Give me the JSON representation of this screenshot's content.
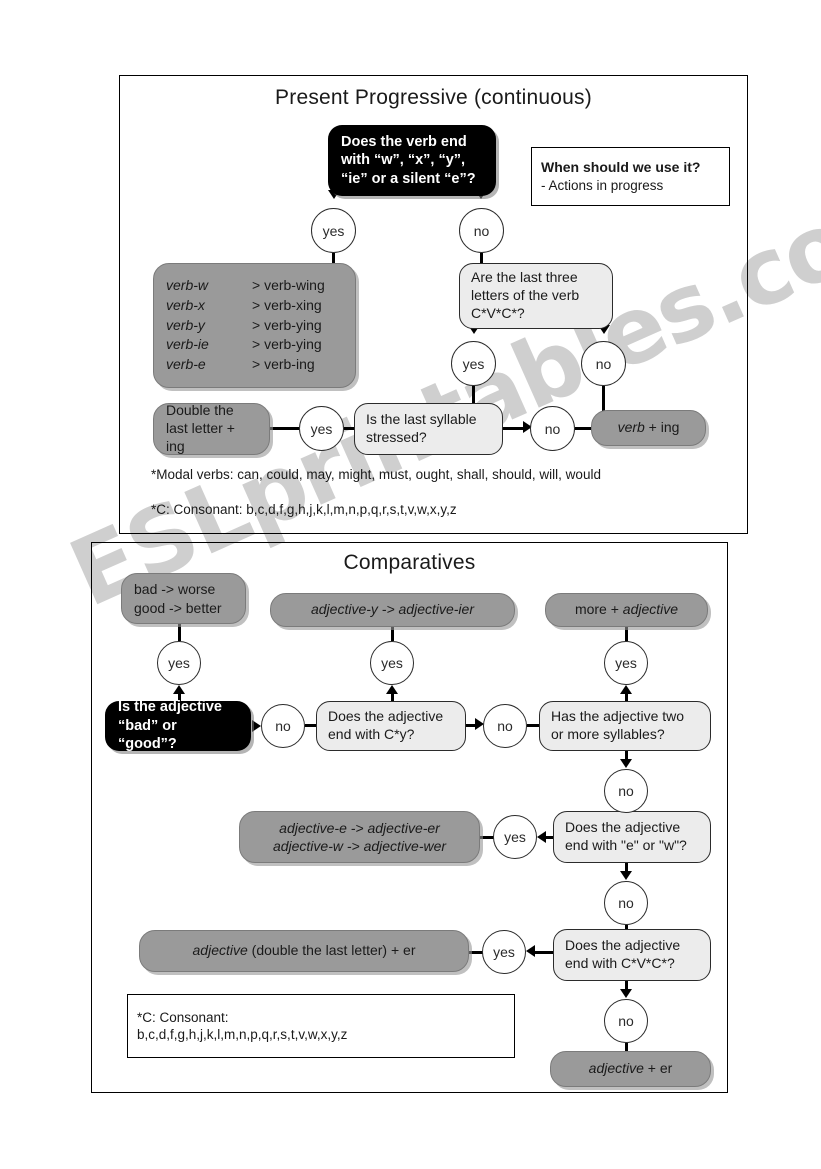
{
  "watermark": {
    "text": "ESLprintables.com"
  },
  "present_progressive": {
    "title": "Present Progressive (continuous)",
    "question_main": "Does the verb end with “w”, “x”, “y”, “ie” or a silent “e”?",
    "usage_box": {
      "heading": "When should we use it?",
      "line": "- Actions in progress"
    },
    "label_yes_1": "yes",
    "label_no_1": "no",
    "rules": [
      {
        "from": "verb-w",
        "to": "> verb-wing"
      },
      {
        "from": "verb-x",
        "to": "> verb-xing"
      },
      {
        "from": "verb-y",
        "to": "> verb-ying"
      },
      {
        "from": "verb-ie",
        "to": "> verb-ying"
      },
      {
        "from": "verb-e",
        "to": "> verb-ing"
      }
    ],
    "question_cvc": "Are the last three letters of the verb C*V*C*?",
    "label_yes_2": "yes",
    "label_no_2": "no",
    "question_stress": "Is the last syllable stressed?",
    "label_yes_3": "yes",
    "label_no_3": "no",
    "result_double": "Double the last letter + ing",
    "result_verb_ing": "verb + ing",
    "footnote_modal": "*Modal verbs: can, could, may, might, must, ought, shall, should, will, would",
    "footnote_consonant": "*C: Consonant: b,c,d,f,g,h,j,k,l,m,n,p,q,r,s,t,v,w,x,y,z"
  },
  "comparatives": {
    "title": "Comparatives",
    "result_irregular": "bad -> worse\ngood -> better",
    "result_y_ier": "adjective-y -> adjective-ier",
    "result_more": "more + adjective",
    "label_yes_1": "yes",
    "label_yes_2": "yes",
    "label_yes_3": "yes",
    "question_badgood": "Is the adjective “bad” or “good”?",
    "label_no_1": "no",
    "question_cy": "Does the adjective end with C*y?",
    "label_no_2": "no",
    "question_syllables": "Has the adjective two or more syllables?",
    "label_no_3": "no",
    "result_e_w": "adjective-e -> adjective-er\nadjective-w -> adjective-wer",
    "label_yes_4": "yes",
    "question_e_or_w": "Does the adjective end with \"e\" or \"w\"?",
    "label_no_4": "no",
    "result_double_er": "adjective (double the last letter) + er",
    "label_yes_5": "yes",
    "question_cvc": "Does the adjective end with C*V*C*?",
    "label_no_5": "no",
    "result_adjective_er": "adjective + er",
    "footnote_box": {
      "line1": "*C: Consonant:",
      "line2": "b,c,d,f,g,h,j,k,l,m,n,p,q,r,s,t,v,w,x,y,z"
    }
  }
}
